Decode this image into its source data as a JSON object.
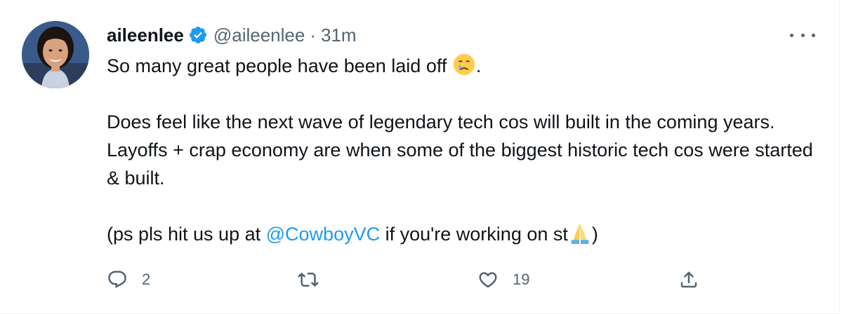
{
  "tweet": {
    "author_name": "aileenlee",
    "verified": true,
    "handle": "@aileenlee",
    "separator": "·",
    "timestamp": "31m",
    "line1_text": "So many great people have been laid off ",
    "line1_end": ".",
    "para2": "Does feel like the next wave of legendary tech cos will built in the coming years. Layoffs + crap economy are when some of the biggest historic tech cos were started & built.",
    "para3_prefix": "(ps pls hit us up at ",
    "mention": "@CowboyVC",
    "para3_mid": " if you're working on st",
    "para3_suffix": ")",
    "emojis": [
      "crying-face",
      "folded-hands"
    ]
  },
  "actions": {
    "reply_count": "2",
    "retweet_count": "",
    "like_count": "19"
  },
  "colors": {
    "text": "#0f1419",
    "secondary": "#536471",
    "accent": "#1d9bf0",
    "border": "#eff3f4"
  },
  "icons": [
    "verified-badge-icon",
    "more-options-icon",
    "reply-icon",
    "retweet-icon",
    "like-icon",
    "share-icon"
  ]
}
